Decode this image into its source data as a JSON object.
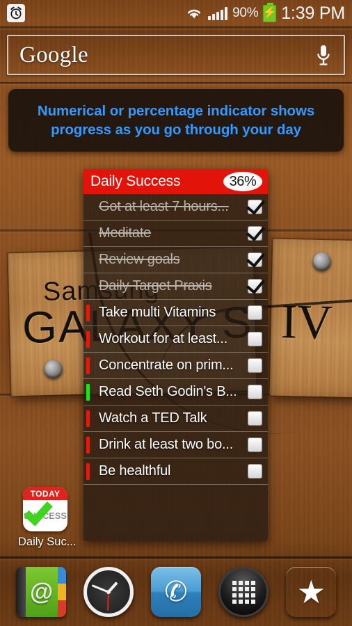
{
  "statusbar": {
    "alarm_icon": "alarm-clock-icon",
    "wifi_icon": "wifi-icon",
    "signal_icon": "cellular-signal-icon",
    "battery_percent": "90%",
    "battery_icon": "battery-charging-icon",
    "clock": "1:39 PM"
  },
  "search": {
    "brand": "Google",
    "mic_icon": "microphone-icon"
  },
  "callout": {
    "text": "Numerical or percentage indicator shows progress as you go through your day",
    "color": "#3399ff"
  },
  "widget": {
    "title": "Daily Success",
    "progress_badge": "36%",
    "header_color": "#e2140a",
    "items": [
      {
        "label": "Got at least 7 hours...",
        "done": true,
        "priority_color": ""
      },
      {
        "label": "Meditate",
        "done": true,
        "priority_color": ""
      },
      {
        "label": "Review goals",
        "done": true,
        "priority_color": ""
      },
      {
        "label": "Daily Target Praxis",
        "done": true,
        "priority_color": ""
      },
      {
        "label": "Take multi Vitamins",
        "done": false,
        "priority_color": "#e01c0d"
      },
      {
        "label": "Workout for at least...",
        "done": false,
        "priority_color": "#e01c0d"
      },
      {
        "label": "Concentrate on prim...",
        "done": false,
        "priority_color": "#e01c0d"
      },
      {
        "label": "Read Seth Godin's B...",
        "done": false,
        "priority_color": "#19e619"
      },
      {
        "label": "Watch a TED Talk",
        "done": false,
        "priority_color": "#e01c0d"
      },
      {
        "label": "Drink at least two bo...",
        "done": false,
        "priority_color": "#e01c0d"
      },
      {
        "label": "Be healthful",
        "done": false,
        "priority_color": "#e01c0d"
      }
    ]
  },
  "app_icon": {
    "badge_top": "TODAY",
    "badge_body": "SUCCESS",
    "label": "Daily Suc..."
  },
  "wallpaper": {
    "brand_text": "Samsung",
    "model_text": "GALAXY S",
    "roman_text": "IV"
  },
  "dock": [
    {
      "name": "contacts-app",
      "glyph": "@"
    },
    {
      "name": "clock-app",
      "glyph": ""
    },
    {
      "name": "phone-app",
      "glyph": "✆"
    },
    {
      "name": "app-drawer",
      "glyph": ""
    },
    {
      "name": "bookmarks-app",
      "glyph": "★"
    }
  ]
}
